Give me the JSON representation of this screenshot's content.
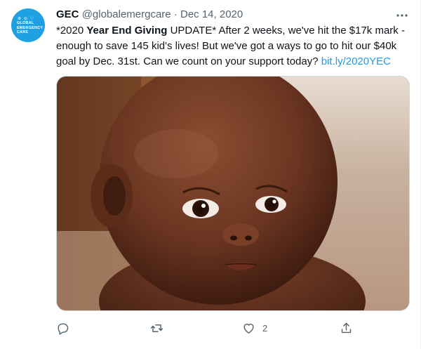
{
  "tweet": {
    "author": {
      "name": "GEC",
      "handle": "@globalemergcare",
      "avatar_text": [
        "GLOBAL",
        "EMERGENCY",
        "CARE"
      ]
    },
    "separator": "·",
    "date": "Dec 14, 2020",
    "text": {
      "p1": "*2020 ",
      "bold": "Year End Giving",
      "p2": " UPDATE*  After 2 weeks, we've hit the $17k mark - enough to save 145 kid's lives! But we've got a ways to go to hit our $40k goal by Dec. 31st. Can we count on your support today? ",
      "link": "bit.ly/2020YEC"
    },
    "actions": {
      "reply_icon": "reply-icon",
      "retweet_icon": "retweet-icon",
      "like_icon": "heart-icon",
      "like_count": "2",
      "share_icon": "share-icon"
    },
    "colors": {
      "link": "#1d9bf0",
      "secondary_text": "#536471",
      "avatar_bg": "#1da1e2"
    }
  }
}
